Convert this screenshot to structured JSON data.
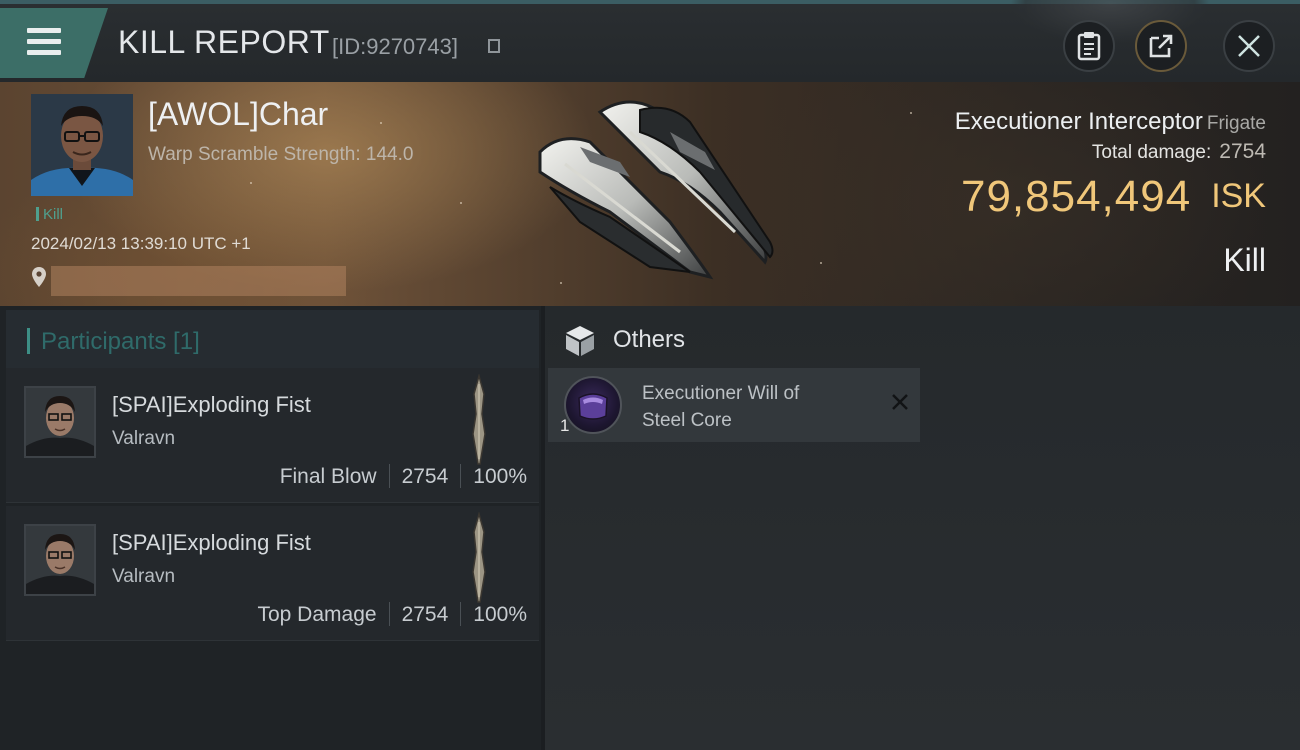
{
  "header": {
    "title": "KILL REPORT",
    "id_text": "[ID:9270743]",
    "icons": [
      "menu-icon",
      "copy-icon",
      "clipboard-icon",
      "share-icon",
      "close-icon"
    ]
  },
  "victim": {
    "name": "[AWOL]Char",
    "warp_scramble": "Warp Scramble Strength: 144.0",
    "kill_tag": "Kill",
    "datetime": "2024/02/13 13:39:10 UTC +1",
    "ship_name": "Executioner Interceptor",
    "ship_class": "Frigate",
    "total_damage_label": "Total damage:",
    "total_damage": "2754",
    "isk_value": "79,854,494",
    "isk_currency": "ISK",
    "result": "Kill"
  },
  "participants": {
    "header": "Participants [1]",
    "rows": [
      {
        "name": "[SPAI]Exploding Fist",
        "ship": "Valravn",
        "role": "Final Blow",
        "damage": "2754",
        "percent": "100%"
      },
      {
        "name": "[SPAI]Exploding Fist",
        "ship": "Valravn",
        "role": "Top Damage",
        "damage": "2754",
        "percent": "100%"
      }
    ]
  },
  "others": {
    "header": "Others",
    "items": [
      {
        "qty": "1",
        "name": "Executioner Will of Steel Core"
      }
    ]
  },
  "colors": {
    "accent_teal": "#3c6e67",
    "isk_gold": "#f0c77a",
    "kill_green": "#4fa08e"
  }
}
